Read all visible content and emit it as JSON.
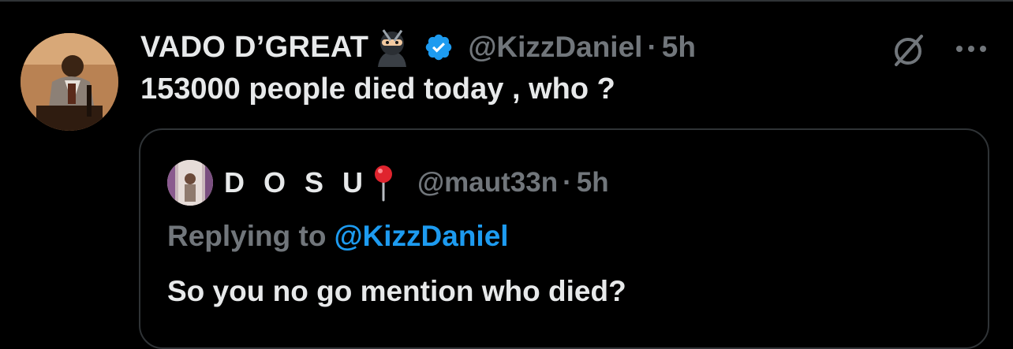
{
  "tweet": {
    "display_name": "VADO D’GREAT",
    "handle": "@KizzDaniel",
    "separator": "·",
    "time": "5h",
    "text": "153000 people died today , who ?",
    "name_emoji": "ninja-emoji",
    "verified": true
  },
  "quoted_tweet": {
    "display_name": "D O S U",
    "name_emoji": "round-pushpin-emoji",
    "handle": "@maut33n",
    "separator": "·",
    "time": "5h",
    "replying_prefix": "Replying to",
    "replying_mention": "@KizzDaniel",
    "text": "So you no go mention who died?"
  },
  "colors": {
    "background": "#000000",
    "primary_text": "#e7e9ea",
    "secondary_text": "#71767b",
    "accent": "#1d9bf0",
    "border": "#2f3336"
  },
  "icons": {
    "grok": "grok-icon",
    "more": "more-icon",
    "verified": "verified-badge-icon"
  }
}
